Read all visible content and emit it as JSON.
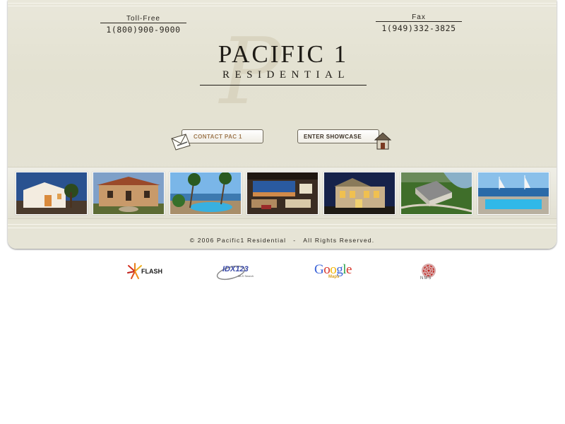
{
  "header": {
    "toll_free_label": "Toll-Free",
    "toll_free_number": "1(800)900-9000",
    "fax_label": "Fax",
    "fax_number": "1(949)332-3825"
  },
  "logo": {
    "title": "PACIFIC 1",
    "subtitle": "RESIDENTIAL"
  },
  "buttons": {
    "contact_label": "CONTACT PAC 1",
    "showcase_label": "ENTER SHOWCASE"
  },
  "gallery": {
    "photos": [
      {
        "name": "white villa at dusk"
      },
      {
        "name": "tuscan estate with fountain"
      },
      {
        "name": "pool with palm trees"
      },
      {
        "name": "living room with ocean view"
      },
      {
        "name": "estate at night"
      },
      {
        "name": "aerial waterfront estate"
      },
      {
        "name": "infinity pool by the harbor"
      }
    ]
  },
  "footer": {
    "copyright": "© 2006 Pacific1 Residential",
    "separator": "-",
    "rights": "All Rights Reserved."
  },
  "partners": {
    "flash": "FLASH",
    "idx": "IDX123",
    "idx_sub": "MLS Search",
    "google_letters": [
      "G",
      "o",
      "o",
      "g",
      "l",
      "e"
    ],
    "google_sub": "Maps",
    "nms": "NMS"
  },
  "colors": {
    "panel": "#e6e4d6",
    "text": "#2a2620",
    "contact_text": "#a07a52"
  }
}
